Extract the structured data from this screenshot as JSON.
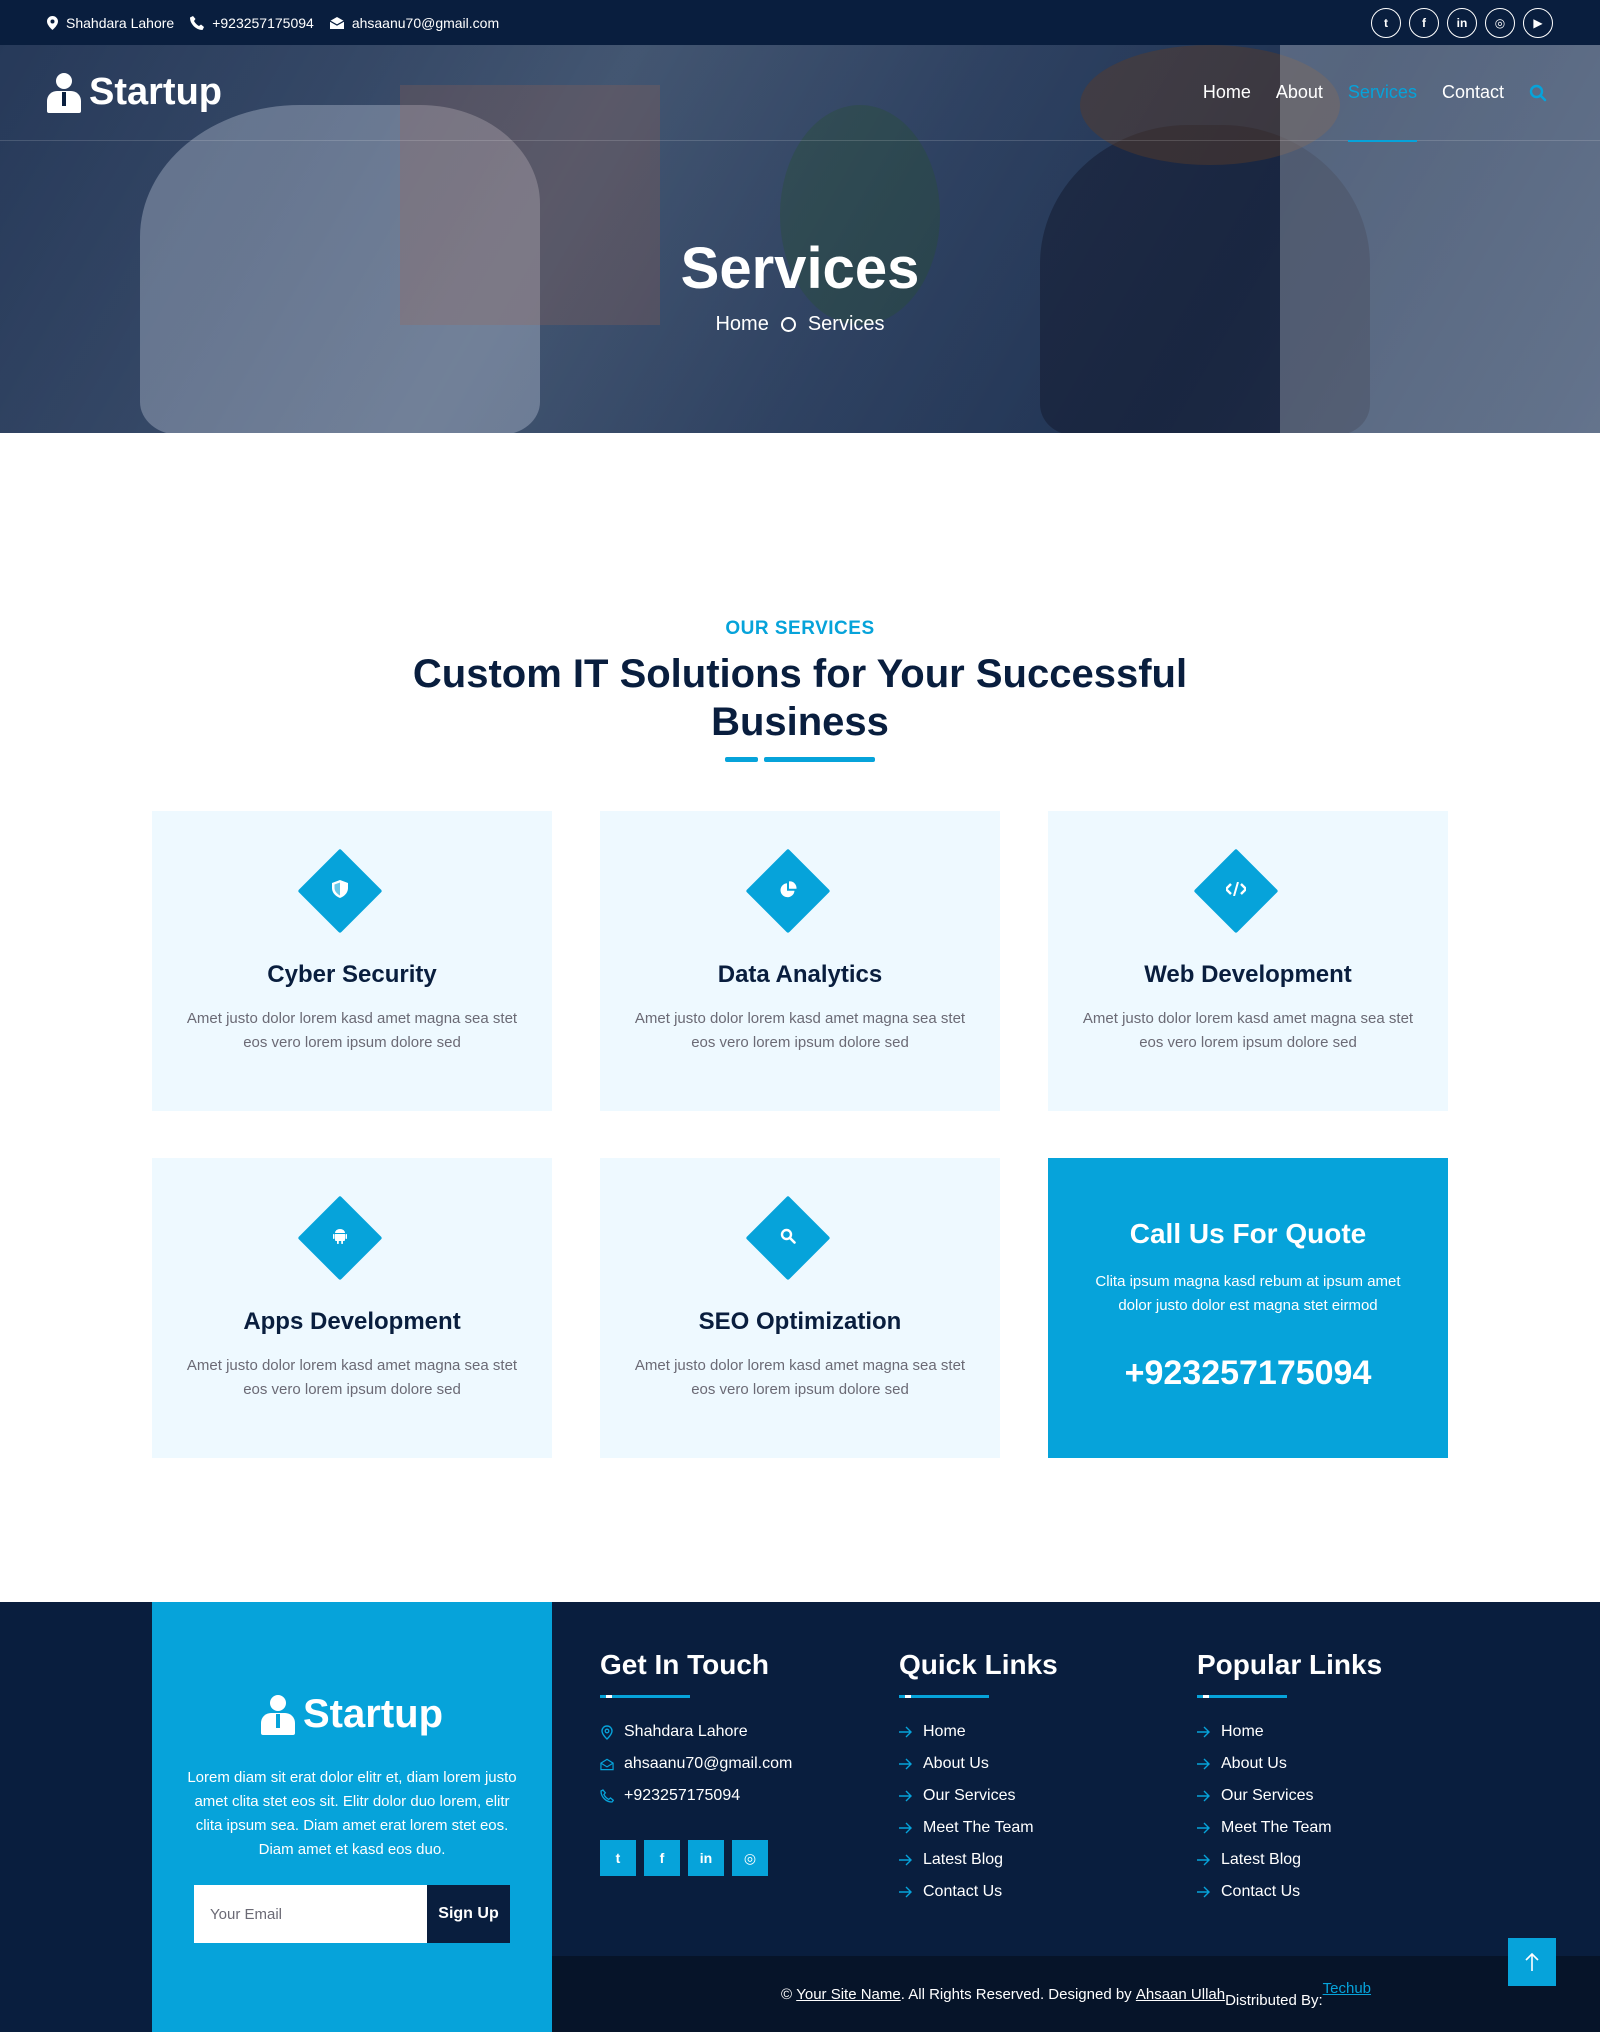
{
  "topbar": {
    "location": "Shahdara Lahore",
    "phone": "+923257175094",
    "email": "ahsaanu70@gmail.com",
    "socials": [
      "twitter-icon",
      "facebook-icon",
      "linkedin-icon",
      "instagram-icon",
      "youtube-icon"
    ]
  },
  "nav": {
    "brand": "Startup",
    "items": [
      "Home",
      "About",
      "Services",
      "Contact"
    ],
    "active": "Services"
  },
  "hero": {
    "title": "Services",
    "crumb_home": "Home",
    "crumb_current": "Services"
  },
  "section": {
    "subtitle": "OUR SERVICES",
    "title": "Custom IT Solutions for Your Successful Business"
  },
  "services": [
    {
      "title": "Cyber Security",
      "desc": "Amet justo dolor lorem kasd amet magna sea stet eos vero lorem ipsum dolore sed",
      "icon": "shield-icon"
    },
    {
      "title": "Data Analytics",
      "desc": "Amet justo dolor lorem kasd amet magna sea stet eos vero lorem ipsum dolore sed",
      "icon": "chart-pie-icon"
    },
    {
      "title": "Web Development",
      "desc": "Amet justo dolor lorem kasd amet magna sea stet eos vero lorem ipsum dolore sed",
      "icon": "code-icon"
    },
    {
      "title": "Apps Development",
      "desc": "Amet justo dolor lorem kasd amet magna sea stet eos vero lorem ipsum dolore sed",
      "icon": "android-icon"
    },
    {
      "title": "SEO Optimization",
      "desc": "Amet justo dolor lorem kasd amet magna sea stet eos vero lorem ipsum dolore sed",
      "icon": "search-icon"
    }
  ],
  "quote": {
    "title": "Call Us For Quote",
    "desc": "Clita ipsum magna kasd rebum at ipsum amet dolor justo dolor est magna stet eirmod",
    "phone": "+923257175094"
  },
  "footer": {
    "brand": "Startup",
    "about": "Lorem diam sit erat dolor elitr et, diam lorem justo amet clita stet eos sit. Elitr dolor duo lorem, elitr clita ipsum sea. Diam amet erat lorem stet eos. Diam amet et kasd eos duo.",
    "email_placeholder": "Your Email",
    "signup": "Sign Up",
    "contact_title": "Get In Touch",
    "contact": {
      "location": "Shahdara Lahore",
      "email": "ahsaanu70@gmail.com",
      "phone": "+923257175094"
    },
    "quick_title": "Quick Links",
    "quick_links": [
      "Home",
      "About Us",
      "Our Services",
      "Meet The Team",
      "Latest Blog",
      "Contact Us"
    ],
    "popular_title": "Popular Links",
    "popular_links": [
      "Home",
      "About Us",
      "Our Services",
      "Meet The Team",
      "Latest Blog",
      "Contact Us"
    ],
    "copyright_prefix": "©",
    "site_name": "Your Site Name",
    "rights": ". All Rights Reserved. Designed by",
    "designer": "Ahsaan Ullah",
    "distributed_by": "Distributed By:",
    "distributor": "Techub"
  },
  "colors": {
    "primary": "#06A3DA",
    "dark": "#091E3E",
    "light": "#EEF9FF"
  }
}
